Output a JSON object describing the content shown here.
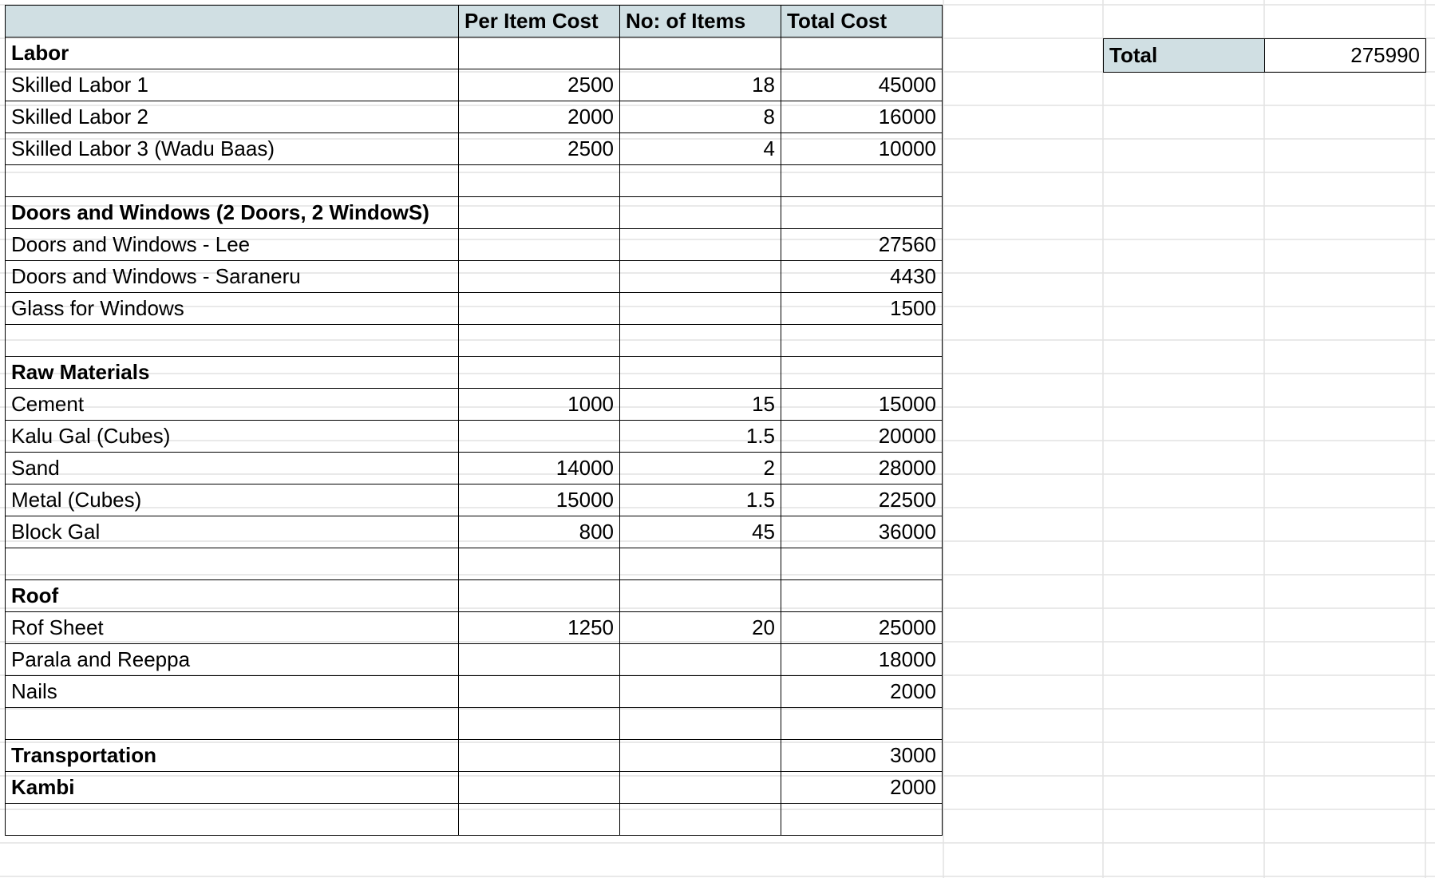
{
  "header": {
    "col1": "",
    "col2": "Per Item Cost",
    "col3": "No: of Items",
    "col4": "Total Cost"
  },
  "rows": [
    {
      "kind": "cat",
      "label": "Labor",
      "per": "",
      "qty": "",
      "total": ""
    },
    {
      "kind": "item",
      "label": "Skilled Labor 1",
      "per": "2500",
      "qty": "18",
      "total": "45000"
    },
    {
      "kind": "item",
      "label": "Skilled Labor 2",
      "per": "2000",
      "qty": "8",
      "total": "16000"
    },
    {
      "kind": "item",
      "label": "Skilled Labor 3 (Wadu Baas)",
      "per": "2500",
      "qty": "4",
      "total": "10000"
    },
    {
      "kind": "blank",
      "label": "",
      "per": "",
      "qty": "",
      "total": ""
    },
    {
      "kind": "cat",
      "label": "Doors and Windows (2 Doors, 2 WindowS)",
      "per": "",
      "qty": "",
      "total": ""
    },
    {
      "kind": "item",
      "label": "Doors and Windows - Lee",
      "per": "",
      "qty": "",
      "total": "27560"
    },
    {
      "kind": "item",
      "label": "Doors and Windows - Saraneru",
      "per": "",
      "qty": "",
      "total": "4430"
    },
    {
      "kind": "item",
      "label": "Glass for Windows",
      "per": "",
      "qty": "",
      "total": "1500"
    },
    {
      "kind": "blank",
      "label": "",
      "per": "",
      "qty": "",
      "total": ""
    },
    {
      "kind": "cat",
      "label": "Raw Materials",
      "per": "",
      "qty": "",
      "total": ""
    },
    {
      "kind": "item2",
      "label": "Cement",
      "per": "1000",
      "qty": "15",
      "total": "15000"
    },
    {
      "kind": "item2",
      "label": "Kalu Gal (Cubes)",
      "per": "",
      "qty": "1.5",
      "total": "20000"
    },
    {
      "kind": "item2",
      "label": "Sand",
      "per": "14000",
      "qty": "2",
      "total": "28000"
    },
    {
      "kind": "item2",
      "label": "Metal (Cubes)",
      "per": "15000",
      "qty": "1.5",
      "total": "22500"
    },
    {
      "kind": "item2",
      "label": "Block Gal",
      "per": "800",
      "qty": "45",
      "total": "36000"
    },
    {
      "kind": "blank",
      "label": "",
      "per": "",
      "qty": "",
      "total": ""
    },
    {
      "kind": "cat",
      "label": "Roof",
      "per": "",
      "qty": "",
      "total": ""
    },
    {
      "kind": "item2",
      "label": "Rof Sheet",
      "per": "1250",
      "qty": "20",
      "total": "25000"
    },
    {
      "kind": "item2",
      "label": "Parala and Reeppa",
      "per": "",
      "qty": "",
      "total": "18000"
    },
    {
      "kind": "item2",
      "label": "Nails",
      "per": "",
      "qty": "",
      "total": "2000"
    },
    {
      "kind": "blank",
      "label": "",
      "per": "",
      "qty": "",
      "total": ""
    },
    {
      "kind": "cat",
      "label": "Transportation",
      "per": "",
      "qty": "",
      "total": "3000"
    },
    {
      "kind": "cat",
      "label": "Kambi",
      "per": "",
      "qty": "",
      "total": "2000"
    },
    {
      "kind": "blank",
      "label": "",
      "per": "",
      "qty": "",
      "total": ""
    }
  ],
  "summary": {
    "label": "Total",
    "value": "275990"
  },
  "colors": {
    "header_fill": "#d0dfe3",
    "grid_line": "#e2e2e2",
    "border": "#000000"
  }
}
